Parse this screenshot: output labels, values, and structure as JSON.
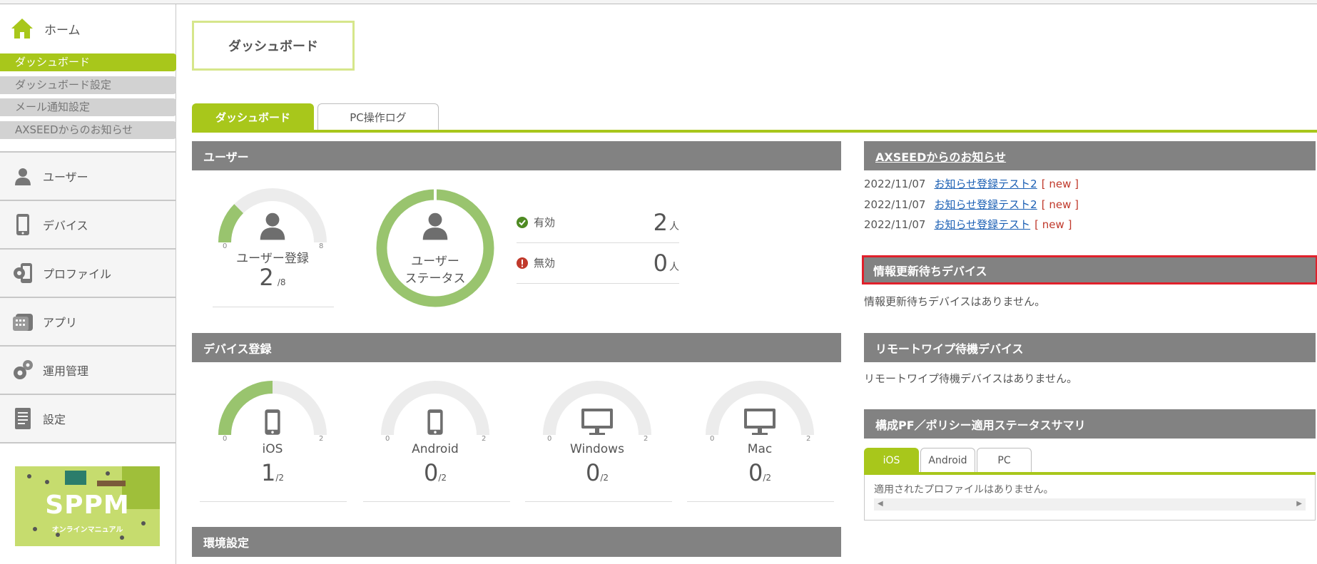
{
  "sidebar": {
    "home_label": "ホーム",
    "sub_items": [
      {
        "label": "ダッシュボード",
        "active": true
      },
      {
        "label": "ダッシュボード設定",
        "active": false
      },
      {
        "label": "メール通知設定",
        "active": false
      },
      {
        "label": "AXSEEDからのお知らせ",
        "active": false
      }
    ],
    "main_items": [
      {
        "label": "ユーザー",
        "icon": "user-icon"
      },
      {
        "label": "デバイス",
        "icon": "device-icon"
      },
      {
        "label": "プロファイル",
        "icon": "profile-icon"
      },
      {
        "label": "アプリ",
        "icon": "app-icon"
      },
      {
        "label": "運用管理",
        "icon": "gears-icon"
      },
      {
        "label": "設定",
        "icon": "settings-document-icon"
      }
    ],
    "banner": {
      "title": "SPPM",
      "subtitle": "オンラインマニュアル"
    }
  },
  "page": {
    "title": "ダッシュボード"
  },
  "tabs": [
    {
      "label": "ダッシュボード",
      "active": true
    },
    {
      "label": "PC操作ログ",
      "active": false
    }
  ],
  "users": {
    "header": "ユーザー",
    "registration": {
      "label": "ユーザー登録",
      "value": 2,
      "max": 8,
      "min_label": "0",
      "max_label": "8",
      "denominator_label": "/8"
    },
    "status_label_line1": "ユーザー",
    "status_label_line2": "ステータス",
    "status_rows": [
      {
        "label": "有効",
        "count": "2",
        "unit": "人"
      },
      {
        "label": "無効",
        "count": "0",
        "unit": "人"
      }
    ]
  },
  "devices": {
    "header": "デバイス登録",
    "items": [
      {
        "label": "iOS",
        "value": 1,
        "max": 2,
        "value_label": "1",
        "denominator_label": "/2",
        "min_label": "0",
        "max_label": "2",
        "icon": "smartphone-icon"
      },
      {
        "label": "Android",
        "value": 0,
        "max": 2,
        "value_label": "0",
        "denominator_label": "/2",
        "min_label": "0",
        "max_label": "2",
        "icon": "smartphone-icon"
      },
      {
        "label": "Windows",
        "value": 0,
        "max": 2,
        "value_label": "0",
        "denominator_label": "/2",
        "min_label": "0",
        "max_label": "2",
        "icon": "monitor-icon"
      },
      {
        "label": "Mac",
        "value": 0,
        "max": 2,
        "value_label": "0",
        "denominator_label": "/2",
        "min_label": "0",
        "max_label": "2",
        "icon": "monitor-icon"
      }
    ]
  },
  "environment": {
    "header": "環境設定"
  },
  "news": {
    "header": "AXSEEDからのお知らせ",
    "items": [
      {
        "date": "2022/11/07",
        "title": "お知らせ登録テスト2",
        "tag": "[ new ]"
      },
      {
        "date": "2022/11/07",
        "title": "お知らせ登録テスト2",
        "tag": "[ new ]"
      },
      {
        "date": "2022/11/07",
        "title": "お知らせ登録テスト",
        "tag": "[ new ]"
      }
    ]
  },
  "pending": {
    "header": "情報更新待ちデバイス",
    "message": "情報更新待ちデバイスはありません。"
  },
  "wipe": {
    "header": "リモートワイプ待機デバイス",
    "message": "リモートワイプ待機デバイスはありません。"
  },
  "policy": {
    "header": "構成PF／ポリシー適用ステータスサマリ",
    "tabs": [
      {
        "label": "iOS",
        "active": true
      },
      {
        "label": "Android",
        "active": false
      },
      {
        "label": "PC",
        "active": false
      }
    ],
    "message": "適用されたプロファイルはありません。"
  },
  "colors": {
    "accent": "#a8c71b",
    "gauge_fill": "#99c46e",
    "gauge_track": "#ececec",
    "header_gray": "#828282",
    "highlight_red": "#e0202b"
  }
}
